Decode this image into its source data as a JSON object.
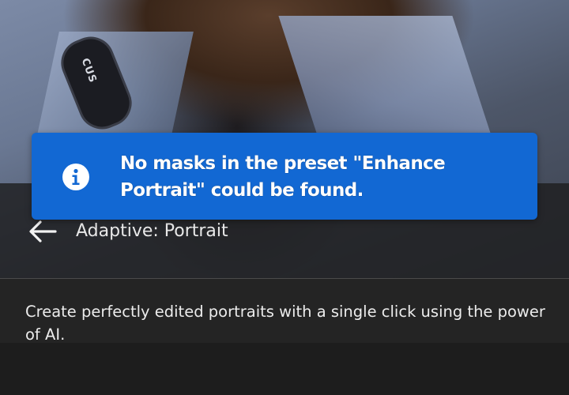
{
  "toast": {
    "message": "No masks in the preset \"Enhance Portrait\" could be found.",
    "icon": "info-icon",
    "background_color": "#1268d3"
  },
  "header": {
    "back_icon": "arrow-left-icon",
    "title": "Adaptive: Portrait"
  },
  "description": "Create perfectly edited portraits with a single click using the power of AI.",
  "photo": {
    "patch_text": "CUS"
  }
}
